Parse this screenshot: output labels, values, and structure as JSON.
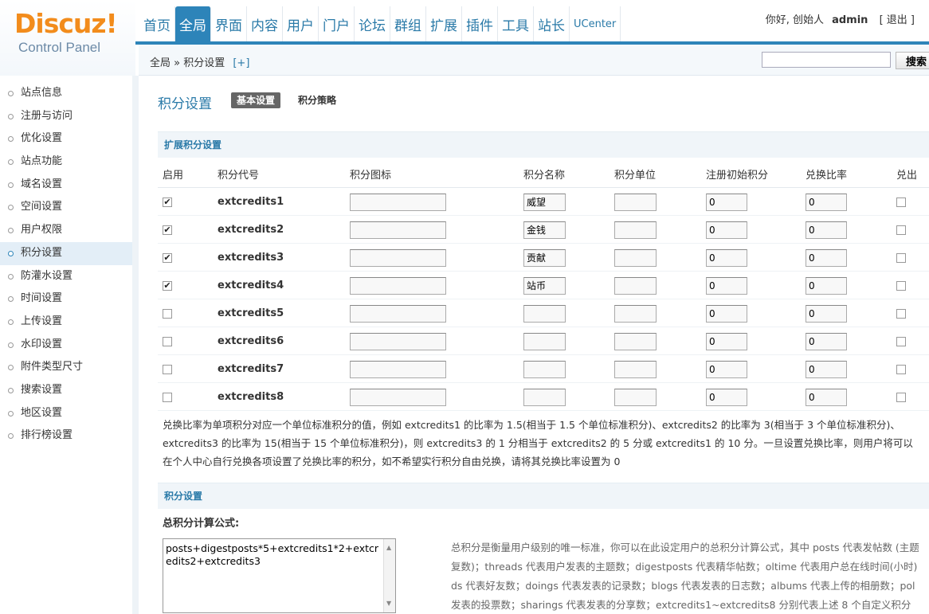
{
  "logo": {
    "brand": "Discuz!",
    "sub": "Control Panel"
  },
  "nav": [
    {
      "label": "首页",
      "active": false
    },
    {
      "label": "全局",
      "active": true
    },
    {
      "label": "界面",
      "active": false
    },
    {
      "label": "内容",
      "active": false
    },
    {
      "label": "用户",
      "active": false
    },
    {
      "label": "门户",
      "active": false
    },
    {
      "label": "论坛",
      "active": false
    },
    {
      "label": "群组",
      "active": false
    },
    {
      "label": "扩展",
      "active": false
    },
    {
      "label": "插件",
      "active": false
    },
    {
      "label": "工具",
      "active": false
    },
    {
      "label": "站长",
      "active": false
    },
    {
      "label": "UCenter",
      "active": false
    }
  ],
  "user": {
    "greeting": "你好, 创始人",
    "name": "admin",
    "logout": "[ 退出 ]"
  },
  "breadcrumb": {
    "text": "全局 » 积分设置",
    "plus": "[+]"
  },
  "search": {
    "value": "",
    "button": "搜索"
  },
  "sidebar": [
    "站点信息",
    "注册与访问",
    "优化设置",
    "站点功能",
    "域名设置",
    "空间设置",
    "用户权限",
    "积分设置",
    "防灌水设置",
    "时间设置",
    "上传设置",
    "水印设置",
    "附件类型尺寸",
    "搜索设置",
    "地区设置",
    "排行榜设置"
  ],
  "sidebar_active": 7,
  "page": {
    "title": "积分设置",
    "tab_basic": "基本设置",
    "tab_strategy": "积分策略"
  },
  "ext_section": {
    "title": "扩展积分设置"
  },
  "columns": [
    "启用",
    "积分代号",
    "积分图标",
    "积分名称",
    "积分单位",
    "注册初始积分",
    "兑换比率",
    "兑出"
  ],
  "rows": [
    {
      "enabled": true,
      "code": "extcredits1",
      "icon": "",
      "name": "威望",
      "unit": "",
      "init": "0",
      "ratio": "0",
      "out": false
    },
    {
      "enabled": true,
      "code": "extcredits2",
      "icon": "",
      "name": "金钱",
      "unit": "",
      "init": "0",
      "ratio": "0",
      "out": false
    },
    {
      "enabled": true,
      "code": "extcredits3",
      "icon": "",
      "name": "贡献",
      "unit": "",
      "init": "0",
      "ratio": "0",
      "out": false
    },
    {
      "enabled": true,
      "code": "extcredits4",
      "icon": "",
      "name": "站币",
      "unit": "",
      "init": "0",
      "ratio": "0",
      "out": false
    },
    {
      "enabled": false,
      "code": "extcredits5",
      "icon": "",
      "name": "",
      "unit": "",
      "init": "0",
      "ratio": "0",
      "out": false
    },
    {
      "enabled": false,
      "code": "extcredits6",
      "icon": "",
      "name": "",
      "unit": "",
      "init": "0",
      "ratio": "0",
      "out": false
    },
    {
      "enabled": false,
      "code": "extcredits7",
      "icon": "",
      "name": "",
      "unit": "",
      "init": "0",
      "ratio": "0",
      "out": false
    },
    {
      "enabled": false,
      "code": "extcredits8",
      "icon": "",
      "name": "",
      "unit": "",
      "init": "0",
      "ratio": "0",
      "out": false
    }
  ],
  "note": [
    "兑换比率为单项积分对应一个单位标准积分的值，例如 extcredits1 的比率为 1.5(相当于 1.5 个单位标准积分)、extcredits2 的比率为 3(相当于 3 个单位标准积分)、",
    "extcredits3 的比率为 15(相当于 15 个单位标准积分)，则 extcredits3 的 1 分相当于 extcredits2 的 5 分或 extcredits1 的 10 分。一旦设置兑换比率，则用户将可以",
    "在个人中心自行兑换各项设置了兑换比率的积分，如不希望实行积分自由兑换，请将其兑换比率设置为 0"
  ],
  "credit_section": {
    "title": "积分设置"
  },
  "formula": {
    "label": "总积分计算公式:",
    "value": "posts+digestposts*5+extcredits1*2+extcredits2+extcredits3",
    "desc": [
      "总积分是衡量用户级别的唯一标准，你可以在此设定用户的总积分计算公式，其中 posts 代表发帖数 (主题",
      "复数)；threads 代表用户发表的主题数；digestposts 代表精华帖数；oltime 代表用户总在线时间(小时)",
      "ds 代表好友数；doings 代表发表的记录数；blogs 代表发表的日志数；albums 代表上传的相册数；pol",
      "发表的投票数；sharings 代表发表的分享数；extcredits1~extcredits8 分别代表上述 8 个自定义积分"
    ]
  },
  "colors": {
    "accent": "#2d84b9",
    "link": "#2a7aa8",
    "brand": "#f28c1c"
  }
}
